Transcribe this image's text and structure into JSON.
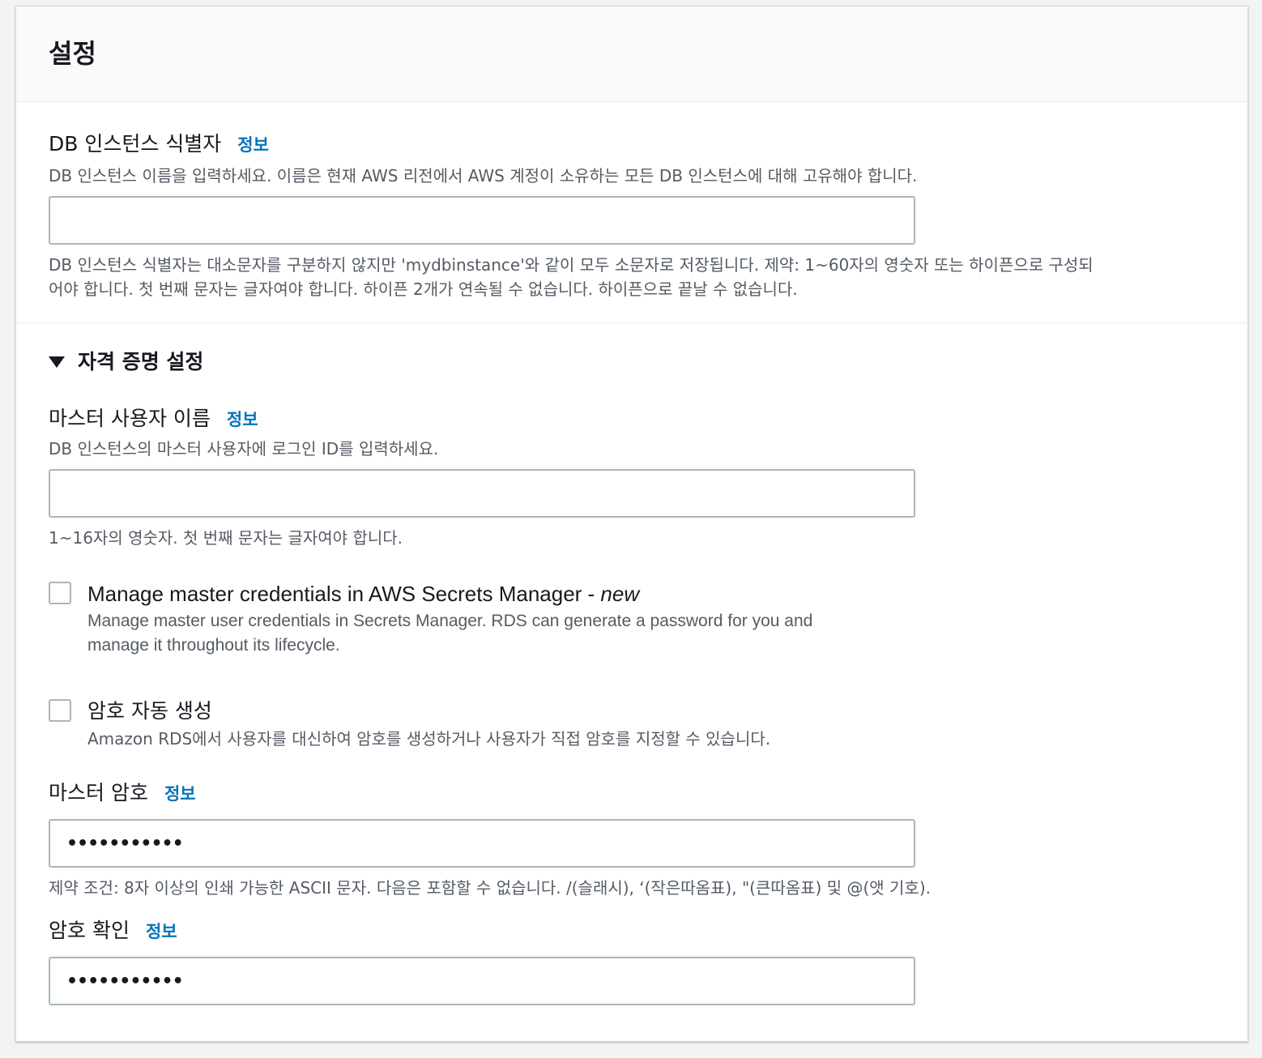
{
  "panel": {
    "title": "설정"
  },
  "db_identifier": {
    "label": "DB 인스턴스 식별자",
    "info": "정보",
    "description": "DB 인스턴스 이름을 입력하세요. 이름은 현재 AWS 리전에서 AWS 계정이 소유하는 모든 DB 인스턴스에 대해 고유해야 합니다.",
    "value": "",
    "constraint_line1": "DB 인스턴스 식별자는 대소문자를 구분하지 않지만 'mydbinstance'와 같이 모두 소문자로 저장됩니다. 제약: 1~60자의 영숫자 또는 하이픈으로 구성되",
    "constraint_line2": "어야 합니다. 첫 번째 문자는 글자여야 합니다. 하이픈 2개가 연속될 수 없습니다. 하이픈으로 끝날 수 없습니다."
  },
  "credentials": {
    "expander_title": "자격 증명 설정",
    "expanded": true,
    "master_username": {
      "label": "마스터 사용자 이름",
      "info": "정보",
      "description": "DB 인스턴스의 마스터 사용자에 로그인 ID를 입력하세요.",
      "value": "",
      "constraint": "1~16자의 영숫자. 첫 번째 문자는 글자여야 합니다."
    },
    "secrets_manager": {
      "label": "Manage master credentials in AWS Secrets Manager - ",
      "label_new": "new",
      "description_line1": "Manage master user credentials in Secrets Manager. RDS can generate a password for you and",
      "description_line2": "manage it throughout its lifecycle.",
      "checked": false
    },
    "auto_password": {
      "label": "암호 자동 생성",
      "description": "Amazon RDS에서 사용자를 대신하여 암호를 생성하거나 사용자가 직접 암호를 지정할 수 있습니다.",
      "checked": false
    },
    "master_password": {
      "label": "마스터 암호",
      "info": "정보",
      "masked_value": "•••••••••••",
      "constraint": "제약 조건: 8자 이상의 인쇄 가능한 ASCII 문자. 다음은 포함할 수 없습니다. /(슬래시), ‘(작은따옴표), \"(큰따옴표) 및 @(앳 기호)."
    },
    "confirm_password": {
      "label": "암호 확인",
      "info": "정보",
      "masked_value": "•••••••••••"
    }
  },
  "colors": {
    "link": "#0073bb",
    "text": "#16191f",
    "secondary_text": "#545b64",
    "border": "#aab7b8",
    "header_bg": "#fafafa"
  }
}
